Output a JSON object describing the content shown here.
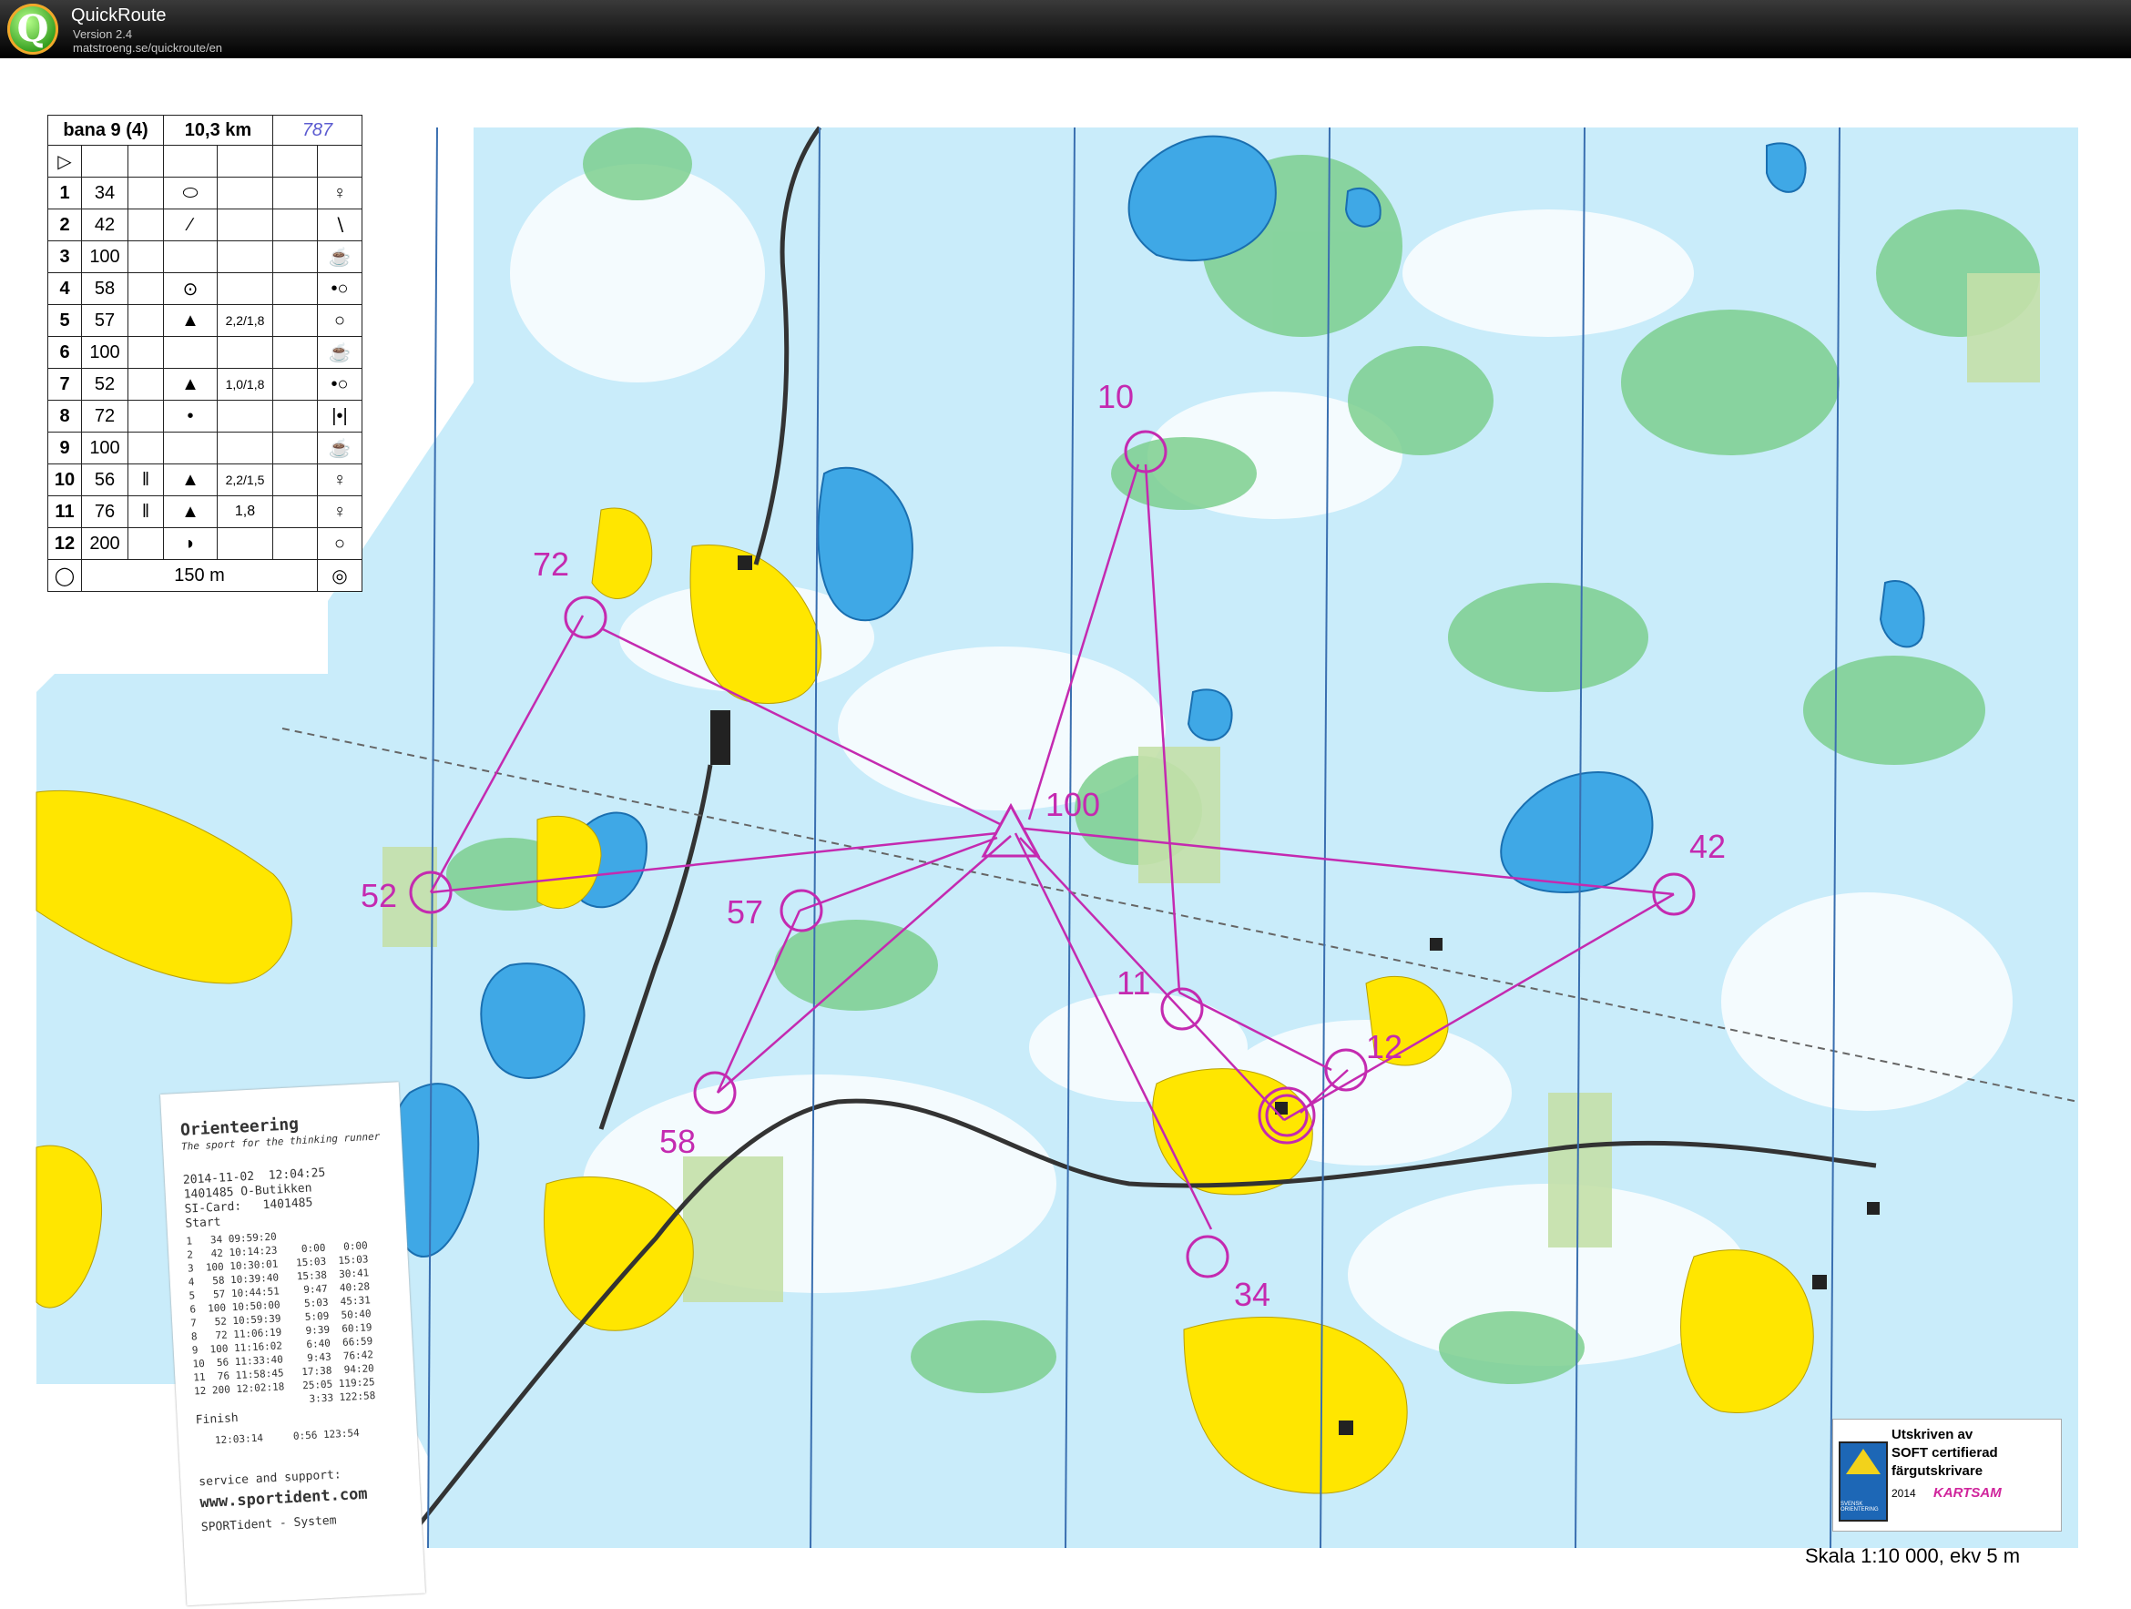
{
  "app": {
    "name": "QuickRoute",
    "version": "Version 2.4",
    "url": "matstroeng.se/quickroute/en"
  },
  "legend": {
    "course": "bana 9 (4)",
    "length": "10,3 km",
    "handwritten": "787",
    "finish_distance": "150 m",
    "controls": [
      {
        "num": "1",
        "code": "34",
        "dim": "",
        "extra": ""
      },
      {
        "num": "2",
        "code": "42",
        "dim": "",
        "extra": ""
      },
      {
        "num": "3",
        "code": "100",
        "dim": "",
        "extra": ""
      },
      {
        "num": "4",
        "code": "58",
        "dim": "",
        "extra": ""
      },
      {
        "num": "5",
        "code": "57",
        "dim": "2,2/1,8",
        "extra": ""
      },
      {
        "num": "6",
        "code": "100",
        "dim": "",
        "extra": ""
      },
      {
        "num": "7",
        "code": "52",
        "dim": "1,0/1,8",
        "extra": ""
      },
      {
        "num": "8",
        "code": "72",
        "dim": "",
        "extra": ""
      },
      {
        "num": "9",
        "code": "100",
        "dim": "",
        "extra": ""
      },
      {
        "num": "10",
        "code": "56",
        "dim": "2,2/1,5",
        "extra": ""
      },
      {
        "num": "11",
        "code": "76",
        "dim": "1,8",
        "extra": ""
      },
      {
        "num": "12",
        "code": "200",
        "dim": "",
        "extra": ""
      }
    ]
  },
  "map": {
    "controls": [
      {
        "label": "10"
      },
      {
        "label": "72"
      },
      {
        "label": "100"
      },
      {
        "label": "42"
      },
      {
        "label": "52"
      },
      {
        "label": "57"
      },
      {
        "label": "11"
      },
      {
        "label": "12"
      },
      {
        "label": "58"
      },
      {
        "label": "34"
      }
    ],
    "colors": {
      "water": "#3fa8e6",
      "marsh": "#a9dcf5",
      "open": "#ffe600",
      "vegetation": "#7ccf8e",
      "course": "#c42ab0"
    }
  },
  "receipt": {
    "title": "Orienteering",
    "subtitle": "The sport for the thinking runner",
    "datetime": "2014-11-02  12:04:25",
    "unit": "1401485 O-Butikken",
    "card": "SI-Card:   1401485",
    "start": "Start",
    "splits": [
      "1   34 09:59:20",
      "2   42 10:14:23    0:00   0:00",
      "3  100 10:30:01   15:03  15:03",
      "4   58 10:39:40   15:38  30:41",
      "5   57 10:44:51    9:47  40:28",
      "6  100 10:50:00    5:03  45:31",
      "7   52 10:59:39    5:09  50:40",
      "8   72 11:06:19    9:39  60:19",
      "9  100 11:16:02    6:40  66:59",
      "10  56 11:33:40    9:43  76:42",
      "11  76 11:58:45   17:38  94:20",
      "12 200 12:02:18   25:05 119:25",
      "                   3:33 122:58"
    ],
    "finish": "Finish",
    "finish_time": "12:03:14     0:56 123:54",
    "support": "service and support:",
    "website": "www.sportident.com",
    "system": "SPORTident - System"
  },
  "certificate": {
    "line1": "Utskriven av",
    "line2": "SOFT certifierad",
    "line3": "färgutskrivare",
    "year": "2014",
    "brand": "KARTSAM",
    "badge": "SVENSK ORIENTERING"
  },
  "scale": "Skala 1:10 000, ekv 5 m"
}
